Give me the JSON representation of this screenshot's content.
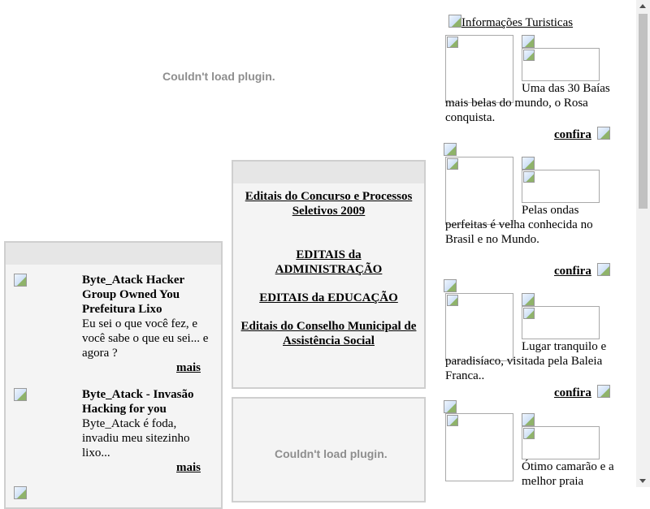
{
  "plugins": {
    "top_message": "Couldn't load plugin.",
    "bottom_message": "Couldn't load plugin."
  },
  "editais": {
    "items": [
      "Editais do Concurso e Processos Seletivos 2009",
      "EDITAIS da ADMINISTRAÇÃO",
      "EDITAIS da EDUCAÇÃO",
      "Editais do Conselho Municipal de Assistência Social"
    ]
  },
  "news": {
    "items": [
      {
        "title": "Byte_Atack Hacker Group Owned You Prefeitura Lixo",
        "body": "Eu sei o que você fez, e você sabe o que eu sei... e agora ?",
        "more": "mais"
      },
      {
        "title": "Byte_Atack - Invasão Hacking for you",
        "body": "Byte_Atack é foda, invadiu meu sitezinho lixo...",
        "more": "mais"
      }
    ]
  },
  "tourism": {
    "header_alt": "Informações Turisticas",
    "items": [
      {
        "text": "Uma das 30 Baías mais belas do mundo, o Rosa conquista.",
        "link": "confira"
      },
      {
        "text": "Pelas ondas perfeitas é velha conhecida no Brasil e no Mundo.",
        "link": "confira"
      },
      {
        "text": "Lugar tranquilo e paradisíaco, visitada pela Baleia Franca..",
        "link": "confira"
      },
      {
        "text": "Ótimo camarão e a melhor praia",
        "link": ""
      }
    ]
  },
  "colors": {
    "panel_border": "#cfcfcf",
    "panel_header": "#e6e6e6",
    "panel_bg": "#f4f4f4",
    "plugin_text": "#8e8e8e"
  }
}
